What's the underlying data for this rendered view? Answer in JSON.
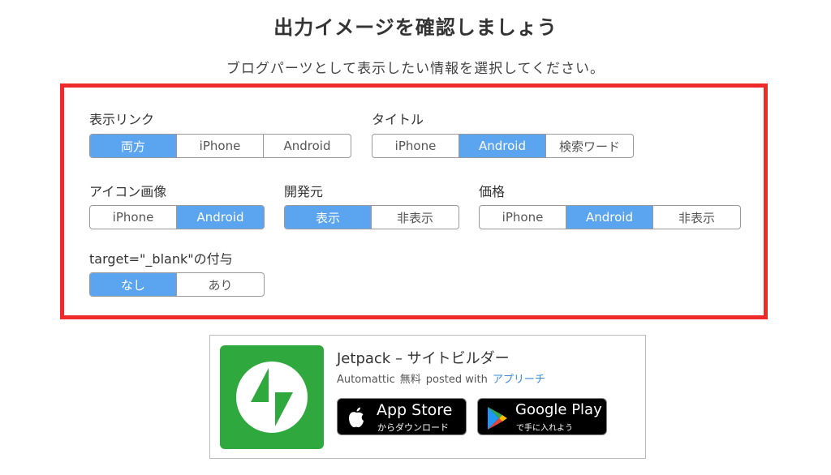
{
  "header": {
    "title": "出力イメージを確認しましょう",
    "subtitle": "ブログパーツとして表示したい情報を選択してください。"
  },
  "options": {
    "display_link": {
      "label": "表示リンク",
      "choices": [
        "両方",
        "iPhone",
        "Android"
      ],
      "selected": "両方"
    },
    "title": {
      "label": "タイトル",
      "choices": [
        "iPhone",
        "Android",
        "検索ワード"
      ],
      "selected": "Android"
    },
    "icon_image": {
      "label": "アイコン画像",
      "choices": [
        "iPhone",
        "Android"
      ],
      "selected": "Android"
    },
    "developer": {
      "label": "開発元",
      "choices": [
        "表示",
        "非表示"
      ],
      "selected": "表示"
    },
    "price": {
      "label": "価格",
      "choices": [
        "iPhone",
        "Android",
        "非表示"
      ],
      "selected": "Android"
    },
    "target_blank": {
      "label": "target=\"_blank\"の付与",
      "choices": [
        "なし",
        "あり"
      ],
      "selected": "なし"
    }
  },
  "preview": {
    "app_name": "Jetpack – サイトビルダー",
    "developer": "Automattic",
    "price": "無料",
    "posted_with": "posted with",
    "posted_with_link": "アプリーチ",
    "app_store": {
      "big": "App Store",
      "small": "からダウンロード"
    },
    "google_play": {
      "big": "Google Play",
      "small": "で手に入れよう"
    }
  },
  "colors": {
    "accent": "#5ba4f0",
    "panel_border": "#ee2a2a",
    "app_icon_bg": "#2fa93d",
    "link": "#3b8ad9"
  }
}
